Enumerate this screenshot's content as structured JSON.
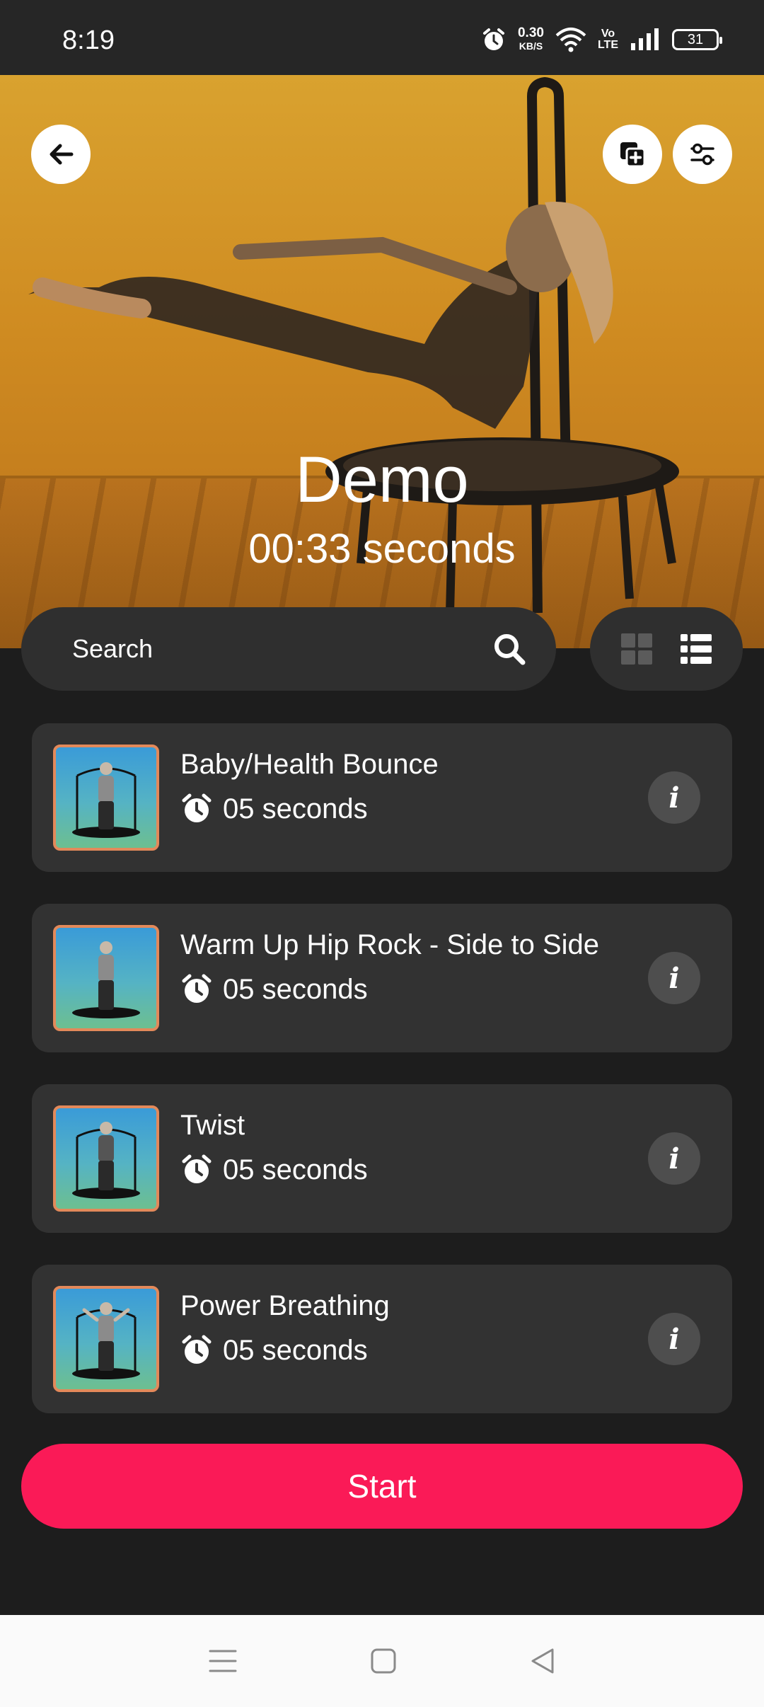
{
  "status_bar": {
    "time": "8:19",
    "net_speed_value": "0.30",
    "net_speed_unit": "KB/S",
    "volte_top": "Vo",
    "volte_bottom": "LTE",
    "battery": "31"
  },
  "hero": {
    "title": "Demo",
    "duration": "00:33 seconds"
  },
  "search": {
    "placeholder": "Search"
  },
  "exercises": [
    {
      "title": "Baby/Health Bounce",
      "duration": "05 seconds",
      "info": "i"
    },
    {
      "title": "Warm Up Hip Rock - Side to Side",
      "duration": "05 seconds",
      "info": "i"
    },
    {
      "title": "Twist",
      "duration": "05 seconds",
      "info": "i"
    },
    {
      "title": "Power Breathing",
      "duration": "05 seconds",
      "info": "i"
    }
  ],
  "start_label": "Start",
  "colors": {
    "accent": "#fa1a57",
    "card": "#323232",
    "background": "#1d1d1d",
    "hero": "#d9a22f",
    "thumb_border": "#e3895a"
  },
  "icons": {
    "back": "arrow-left-icon",
    "add_copy": "add-copy-icon",
    "filter": "sliders-icon",
    "search": "search-icon",
    "grid_view": "grid-icon",
    "list_view": "list-icon",
    "duration": "alarm-clock-icon",
    "info": "info-icon"
  }
}
